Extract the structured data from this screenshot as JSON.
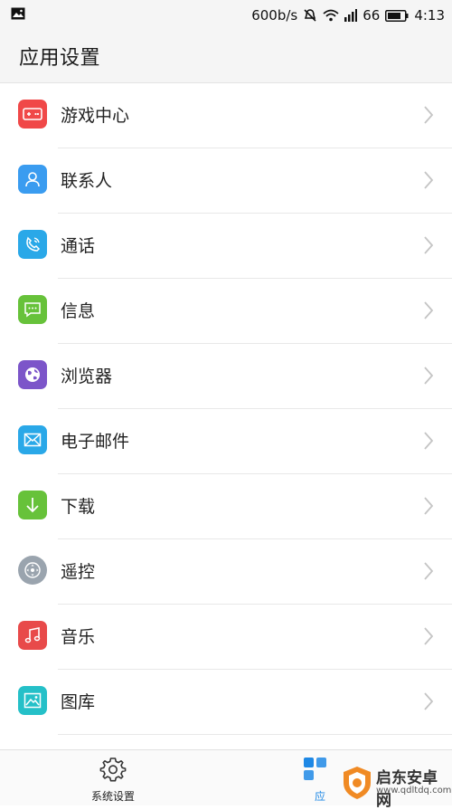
{
  "status_bar": {
    "speed": "600b/s",
    "signal_strength": "66",
    "time": "4:13"
  },
  "header": {
    "title": "应用设置"
  },
  "settings_items": [
    {
      "label": "游戏中心",
      "icon": "gamepad-icon",
      "color": "#f04848"
    },
    {
      "label": "联系人",
      "icon": "contact-icon",
      "color": "#3a9cf0"
    },
    {
      "label": "通话",
      "icon": "phone-icon",
      "color": "#2aa8e8"
    },
    {
      "label": "信息",
      "icon": "message-icon",
      "color": "#67c23a"
    },
    {
      "label": "浏览器",
      "icon": "globe-icon",
      "color": "#7c55c9"
    },
    {
      "label": "电子邮件",
      "icon": "mail-icon",
      "color": "#2aa8e8"
    },
    {
      "label": "下载",
      "icon": "download-icon",
      "color": "#67c23a"
    },
    {
      "label": "遥控",
      "icon": "remote-icon",
      "color": "#9aa4ae"
    },
    {
      "label": "音乐",
      "icon": "music-icon",
      "color": "#e84a4a"
    },
    {
      "label": "图库",
      "icon": "gallery-icon",
      "color": "#25c0c8"
    }
  ],
  "bottom_nav": {
    "settings_label": "系统设置",
    "apps_label": "应"
  },
  "watermark": {
    "text": "启东安卓网",
    "url": "www.qdltdq.com"
  }
}
